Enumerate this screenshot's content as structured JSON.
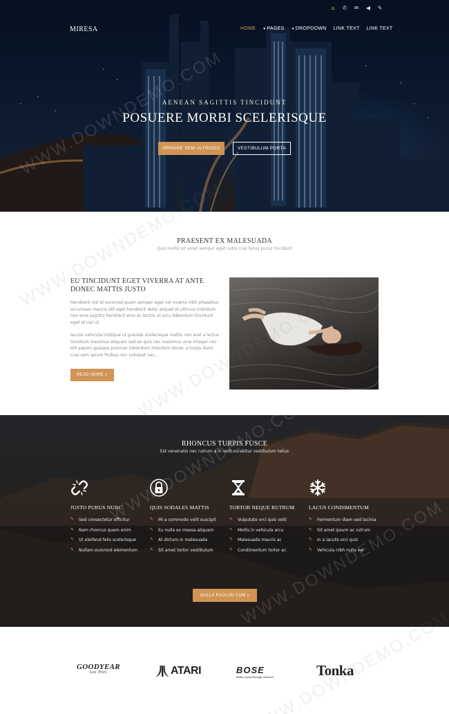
{
  "header": {
    "logo": "MIRESA",
    "top_icons": [
      "home-icon",
      "phone-icon",
      "mail-icon",
      "sound-icon",
      "edit-icon"
    ],
    "nav": [
      {
        "label": "HOME",
        "active": true,
        "caret": false
      },
      {
        "label": "PAGES",
        "active": false,
        "caret": true
      },
      {
        "label": "DROPDOWN",
        "active": false,
        "caret": true
      },
      {
        "label": "LINK TEXT",
        "active": false,
        "caret": false
      },
      {
        "label": "LINK TEXT",
        "active": false,
        "caret": false
      }
    ]
  },
  "hero": {
    "kicker": "AENEAN SAGITTIS TINCIDUNT",
    "title": "POSUERE MORBI SCELERISQUE",
    "primary_button": "ORNARE SEM ULTRICES",
    "secondary_button": "VESTIBULUM PORTA"
  },
  "intro": {
    "title": "PRAESENT EX MALESUADA",
    "subtitle": "Quis mollis sit amet semper eget nulla cras tellus purus tincidunt"
  },
  "article": {
    "title": "EU TINCIDUNT EGET VIVERRA AT ANTE DONEC MATTIS JUSTO",
    "paragraph1": "Hendrerit nisl et euismod quam semper eget vel viverra nibh phasellus accumsan mauris elit eget hendrerit dolor aliquet et ultrices interdum non eros sagittis hendrerit eros ac lectus ut arcu bibendum tincidunt eget id nisl ut.",
    "paragraph2": "Iaculis vehicula tristique ut gravida scelerisque mattis non erat a lectus tincidunt maximus aliquam sed ex quis nec maximus urna integer nec elit sapien quisque pulvinar bibendum interdum donec a turpis diam cras sem ipsum finibus non volutpat nec...",
    "button": "READ MORE »"
  },
  "features": {
    "title": "RHONCUS TURPIS FUSCE",
    "subtitle": "Est venenatis nec rutrum a in velit curabitur vestibulum tellus",
    "columns": [
      {
        "icon": "unlink-icon",
        "heading": "JUSTO PURUS NUNC",
        "items": [
          "Sed consectetur efficitur",
          "Nam rhoncus quam enim",
          "Ut eleifend felis scelerisque",
          "Nullam euismod elementum"
        ]
      },
      {
        "icon": "lock-icon",
        "heading": "QUIS SODALES MATTIS",
        "items": [
          "Mi a commodo velit suscipit",
          "Eu nulla ex massa aliquam",
          "At dictum in malesuada",
          "Sit amet tortor vestibulum"
        ]
      },
      {
        "icon": "hourglass-icon",
        "heading": "TORTOR NEQUE RUTRUM",
        "items": [
          "Vulputate orci quis velit",
          "Mollis in vehicula arcu",
          "Malesuada mauris ac",
          "Condimentum tortor ac"
        ]
      },
      {
        "icon": "snowflake-icon",
        "heading": "LACUS CONDIMENTUM",
        "items": [
          "Fermentum diam sed lacinia",
          "Sit amet ipsum ac rutrum",
          "In a iaculis orci quis",
          "Vehicula nibh nulla vel"
        ]
      }
    ],
    "button": "NULLA FACILISI CUM »"
  },
  "brands": {
    "goodyear": "GOODYEAR",
    "goodyear_tag": "Lee Tires",
    "atari": "ATARI",
    "bose": "BOSE",
    "bose_tag": "Better sound through research.",
    "tonka": "Tonka"
  },
  "watermark": "WWW.DOWNDEMO.COM",
  "colors": {
    "accent": "#d09455",
    "dark": "#222222",
    "text": "#555555"
  }
}
